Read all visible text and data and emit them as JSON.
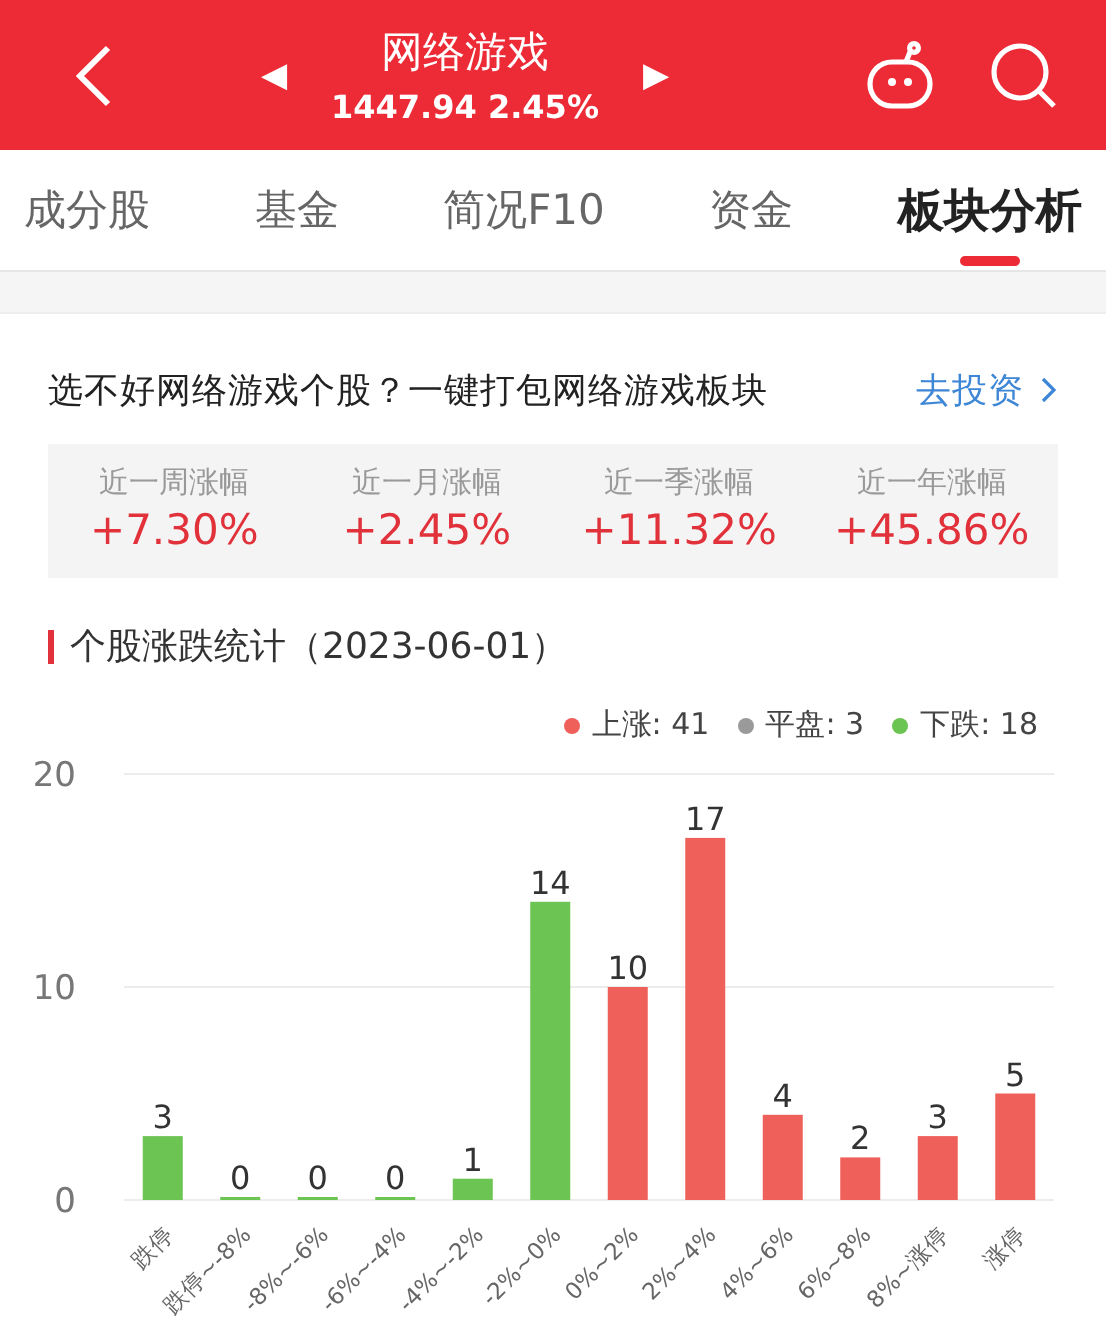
{
  "header": {
    "title": "网络游戏",
    "quote": "1447.94 2.45%",
    "prev_arrow": "◀",
    "next_arrow": "▶"
  },
  "tabs": [
    {
      "label": "成分股",
      "selected": false
    },
    {
      "label": "基金",
      "selected": false
    },
    {
      "label": "简况F10",
      "selected": false
    },
    {
      "label": "资金",
      "selected": false
    },
    {
      "label": "板块分析",
      "selected": true
    }
  ],
  "promo": {
    "text": "选不好网络游戏个股？一键打包网络游戏板块",
    "link": "去投资"
  },
  "returns": [
    {
      "label": "近一周涨幅",
      "value": "+7.30%"
    },
    {
      "label": "近一月涨幅",
      "value": "+2.45%"
    },
    {
      "label": "近一季涨幅",
      "value": "+11.32%"
    },
    {
      "label": "近一年涨幅",
      "value": "+45.86%"
    }
  ],
  "stats": {
    "title": "个股涨跌统计（2023-06-01）",
    "legend": [
      {
        "label": "上涨: 41",
        "color": "#f0605a"
      },
      {
        "label": "平盘: 3",
        "color": "#9a9a9a"
      },
      {
        "label": "下跌: 18",
        "color": "#6cc452"
      }
    ],
    "chart_data": {
      "type": "bar",
      "stacked": true,
      "data_labels": true,
      "ylim": [
        0,
        20
      ],
      "yticks": [
        0,
        10,
        20
      ],
      "categories": [
        "跌停",
        "跌停~-8%",
        "-8%~-6%",
        "-6%~-4%",
        "-4%~-2%",
        "-2%~0%",
        "0%~2%",
        "2%~4%",
        "4%~6%",
        "6%~8%",
        "8%~涨停",
        "涨停"
      ],
      "series": [
        {
          "color": "#6cc452",
          "values": [
            3,
            0,
            0,
            0,
            1,
            14,
            null,
            null,
            null,
            null,
            null,
            null
          ]
        },
        {
          "color": "#f0605a",
          "values": [
            null,
            null,
            null,
            null,
            null,
            null,
            10,
            17,
            4,
            2,
            3,
            5
          ]
        }
      ]
    }
  }
}
